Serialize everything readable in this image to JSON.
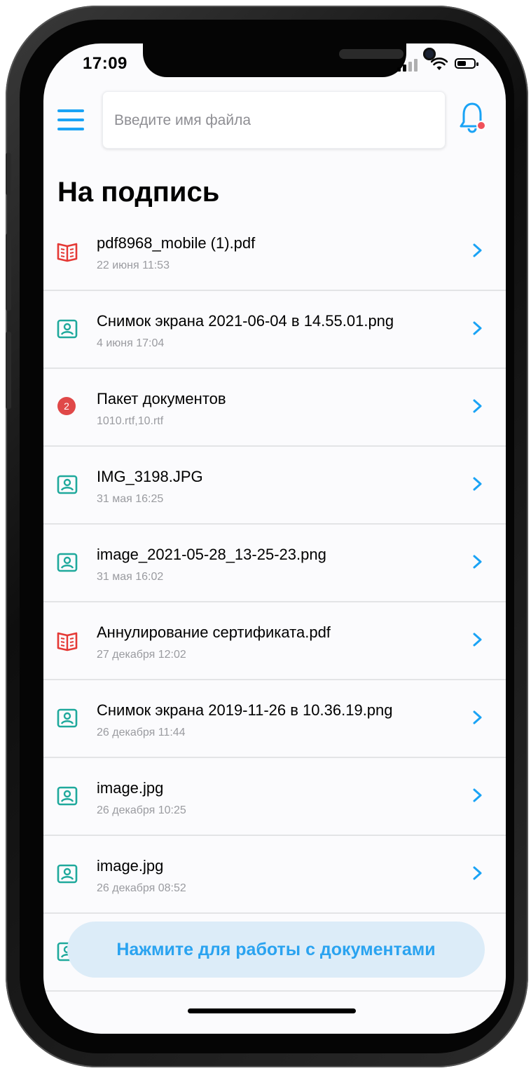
{
  "status_bar": {
    "time": "17:09"
  },
  "search": {
    "placeholder": "Введите имя файла"
  },
  "page": {
    "title": "На подпись"
  },
  "colors": {
    "accent": "#1aa3f5",
    "pdf_icon": "#e53935",
    "image_icon": "#1fa99c",
    "badge": "#e04848"
  },
  "documents": [
    {
      "icon": "pdf-book-icon",
      "name": "pdf8968_mobile (1).pdf",
      "date": "22 июня 11:53"
    },
    {
      "icon": "image-file-icon",
      "name": "Снимок экрана 2021-06-04 в 14.55.01.png",
      "date": "4 июня 17:04"
    },
    {
      "icon": "count-badge",
      "badge": "2",
      "name": "Пакет документов",
      "date": "1010.rtf,10.rtf"
    },
    {
      "icon": "image-file-icon",
      "name": "IMG_3198.JPG",
      "date": "31 мая 16:25"
    },
    {
      "icon": "image-file-icon",
      "name": "image_2021-05-28_13-25-23.png",
      "date": "31 мая 16:02"
    },
    {
      "icon": "pdf-book-icon",
      "name": "Аннулирование сертификата.pdf",
      "date": "27 декабря 12:02"
    },
    {
      "icon": "image-file-icon",
      "name": "Снимок экрана 2019-11-26 в 10.36.19.png",
      "date": "26 декабря 11:44"
    },
    {
      "icon": "image-file-icon",
      "name": "image.jpg",
      "date": "26 декабря 10:25"
    },
    {
      "icon": "image-file-icon",
      "name": "image.jpg",
      "date": "26 декабря 08:52"
    }
  ],
  "cta": {
    "label": "Нажмите для работы с документами"
  }
}
